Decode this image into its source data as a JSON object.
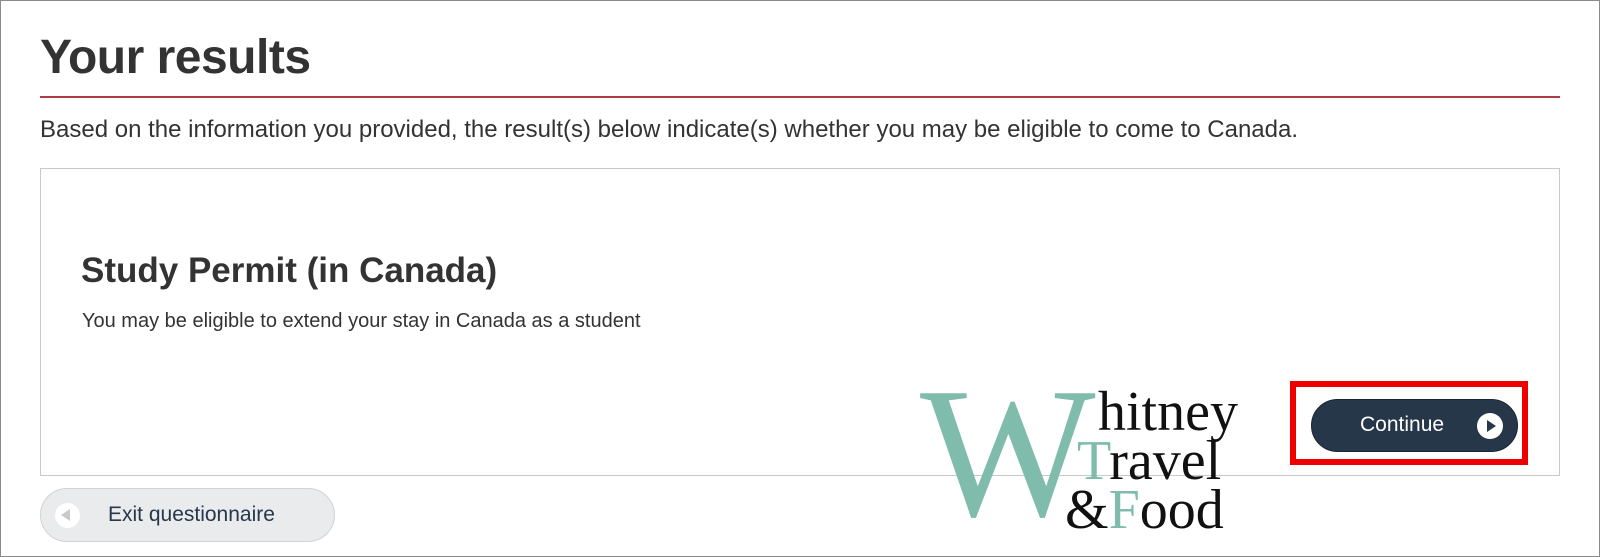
{
  "page": {
    "title": "Your results",
    "intro": "Based on the information you provided, the result(s) below indicate(s) whether you may be eligible to come to Canada."
  },
  "result": {
    "title": "Study Permit (in Canada)",
    "description": "You may be eligible to extend your stay in Canada as a student",
    "continue_label": "Continue",
    "continue_icon": "play-circle-icon"
  },
  "footer": {
    "exit_label": "Exit questionnaire",
    "exit_icon": "back-circle-icon"
  },
  "watermark": {
    "big_letter": "W",
    "line1": "hitney",
    "line2_accent": "T",
    "line2": "ravel",
    "line3_amp": "&",
    "line3_accent": "F",
    "line3": "ood"
  },
  "colors": {
    "accent_rule": "#af3c43",
    "primary_button": "#26374a",
    "highlight": "#ee0000",
    "watermark_teal": "#7fbcab"
  }
}
